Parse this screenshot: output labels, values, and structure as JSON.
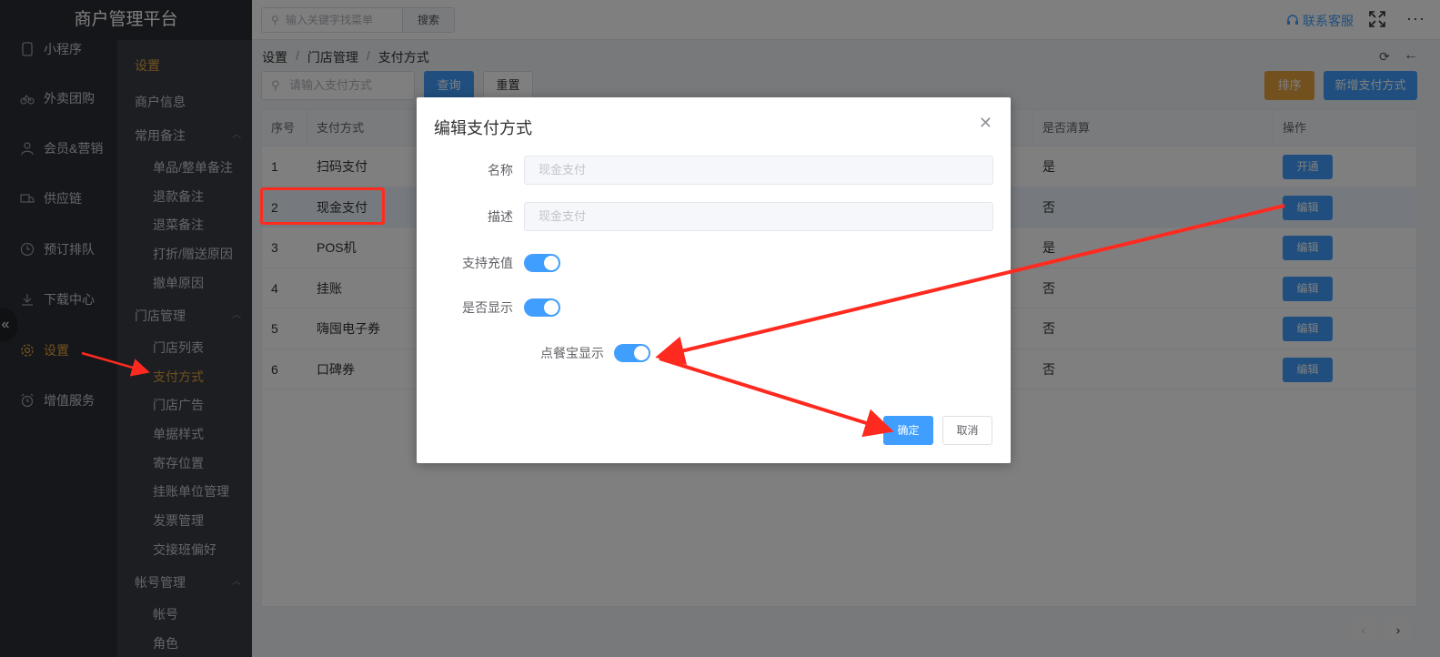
{
  "app": {
    "title": "商户管理平台"
  },
  "header": {
    "search_placeholder": "输入关键字找菜单",
    "search_button": "搜索",
    "contact": "联系客服",
    "more": "···"
  },
  "nav1": [
    {
      "label": "小程序",
      "icon": "phone-icon"
    },
    {
      "label": "外卖团购",
      "icon": "bike-icon"
    },
    {
      "label": "会员&营销",
      "icon": "user-icon"
    },
    {
      "label": "供应链",
      "icon": "truck-icon"
    },
    {
      "label": "预订排队",
      "icon": "clock-icon"
    },
    {
      "label": "下载中心",
      "icon": "download-icon"
    },
    {
      "label": "设置",
      "icon": "gear-icon",
      "active": true
    },
    {
      "label": "增值服务",
      "icon": "alarm-icon"
    }
  ],
  "nav2": {
    "title": "设置",
    "merchant_info": "商户信息",
    "groups": [
      {
        "label": "常用备注",
        "items": [
          "单品/整单备注",
          "退款备注",
          "退菜备注",
          "打折/赠送原因",
          "撤单原因"
        ]
      },
      {
        "label": "门店管理",
        "items": [
          "门店列表",
          "支付方式",
          "门店广告",
          "单据样式",
          "寄存位置",
          "挂账单位管理",
          "发票管理",
          "交接班偏好"
        ]
      },
      {
        "label": "帐号管理",
        "items": [
          "帐号",
          "角色"
        ]
      }
    ],
    "active_item": "支付方式"
  },
  "breadcrumb": [
    "设置",
    "门店管理",
    "支付方式"
  ],
  "toolbar": {
    "pay_placeholder": "请输入支付方式",
    "query": "查询",
    "reset": "重置",
    "sort": "排序",
    "new": "新增支付方式"
  },
  "table": {
    "headers": {
      "index": "序号",
      "method": "支付方式",
      "settle": "是否清算",
      "ops": "操作"
    },
    "rows": [
      {
        "index": "1",
        "method": "扫码支付",
        "settle": "是",
        "op": "开通"
      },
      {
        "index": "2",
        "method": "现金支付",
        "settle": "否",
        "op": "编辑"
      },
      {
        "index": "3",
        "method": "POS机",
        "settle": "是",
        "op": "编辑"
      },
      {
        "index": "4",
        "method": "挂账",
        "settle": "否",
        "op": "编辑"
      },
      {
        "index": "5",
        "method": "嗨囤电子券",
        "settle": "否",
        "op": "编辑"
      },
      {
        "index": "6",
        "method": "口碑券",
        "settle": "否",
        "op": "编辑"
      }
    ]
  },
  "dialog": {
    "title": "编辑支付方式",
    "name_label": "名称",
    "name_value": "现金支付",
    "desc_label": "描述",
    "desc_value": "现金支付",
    "recharge_label": "支持充值",
    "recharge_on": true,
    "show_label": "是否显示",
    "show_on": true,
    "dcb_label": "点餐宝显示",
    "dcb_on": true,
    "ok": "确定",
    "cancel": "取消"
  },
  "colors": {
    "primary": "#409eff",
    "warning": "#e6a23c",
    "annotation": "#ff2a1f"
  }
}
